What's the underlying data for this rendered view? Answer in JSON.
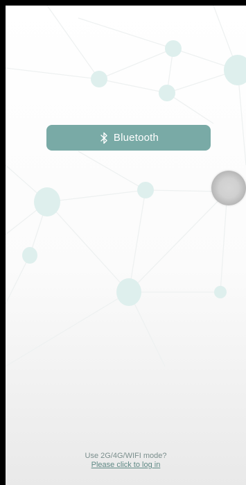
{
  "bluetooth_button": {
    "label": "Bluetooth",
    "icon": "bluetooth-icon",
    "color": "#79aaa6"
  },
  "float_button": {
    "icon": "assistive-touch-button"
  },
  "footer": {
    "mode_text": "Use 2G/4G/WIFI mode?",
    "login_link": "Please click to log in"
  },
  "colors": {
    "background_frame": "#000000",
    "node_fill": "#deefed",
    "line_color": "#eef1f1",
    "accent": "#79aaa6"
  }
}
